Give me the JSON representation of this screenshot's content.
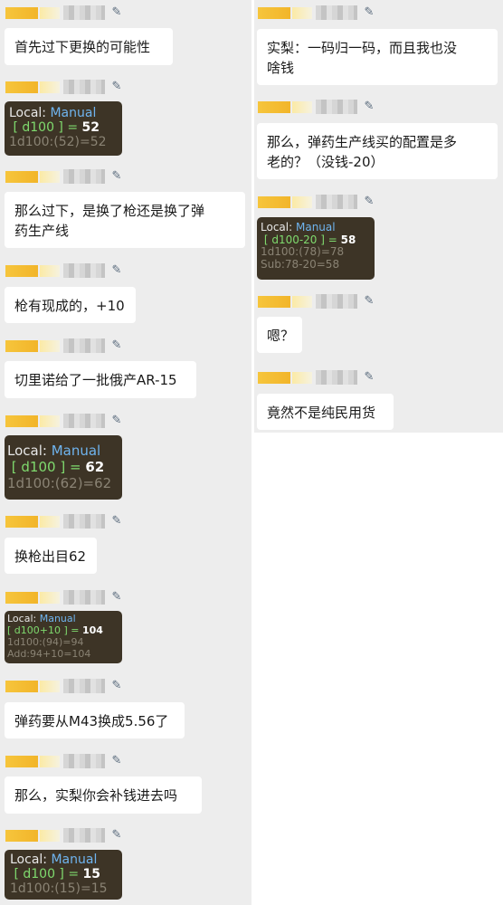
{
  "left": {
    "messages": [
      {
        "text": "首先过下更换的可能性"
      },
      {
        "dice": {
          "local": "Local:",
          "mode": "Manual",
          "expr": "[ d100 ]",
          "eq": "=",
          "result": "52",
          "detail": [
            "1d100:(52)=52"
          ]
        }
      },
      {
        "text": "那么过下，是换了枪还是换了弹\n药生产线"
      },
      {
        "text": "枪有现成的，+10"
      },
      {
        "text": "切里诺给了一批俄产AR-15"
      },
      {
        "dice": {
          "local": "Local:",
          "mode": "Manual",
          "expr": "[ d100 ]",
          "eq": "=",
          "result": "62",
          "detail": [
            "1d100:(62)=62"
          ]
        }
      },
      {
        "text": "换枪出目62"
      },
      {
        "dice": {
          "local": "Local:",
          "mode": "Manual",
          "expr": "[ d100+10 ]",
          "eq": "=",
          "result": "104",
          "detail": [
            "1d100:(94)=94",
            "Add:94+10=104"
          ]
        }
      },
      {
        "text": "弹药要从M43换成5.56了"
      },
      {
        "text": "那么，实梨你会补钱进去吗"
      },
      {
        "dice": {
          "local": "Local:",
          "mode": "Manual",
          "expr": "[ d100 ]",
          "eq": "=",
          "result": "15",
          "detail": [
            "1d100:(15)=15"
          ]
        }
      }
    ]
  },
  "right": {
    "messages": [
      {
        "text": "实梨：一码归一码，而且我也没\n啥钱"
      },
      {
        "text": "那么，弹药生产线买的配置是多\n老的？（没钱-20）"
      },
      {
        "dice": {
          "local": "Local:",
          "mode": "Manual",
          "expr": "[ d100-20 ]",
          "eq": "=",
          "result": "58",
          "detail": [
            "1d100:(78)=78",
            "Sub:78-20=58"
          ]
        }
      },
      {
        "text": "嗯？"
      },
      {
        "text": "竟然不是纯民用货"
      }
    ]
  },
  "icons": {
    "avatar": "avatar-icon"
  },
  "colors": {
    "background": "#ededed",
    "bubble": "#ffffff",
    "dice_bg": "#3d3426",
    "manual": "#6fb4ef",
    "expr": "#7fda6e"
  }
}
